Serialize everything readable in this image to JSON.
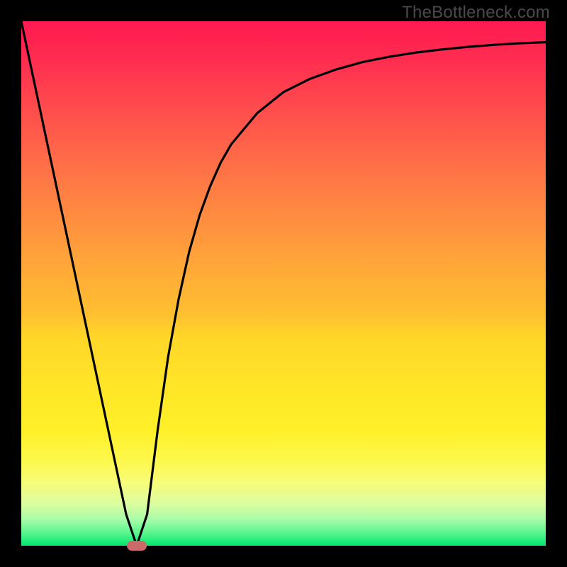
{
  "watermark": "TheBottleneck.com",
  "colors": {
    "frame": "#000000",
    "curve": "#000000",
    "marker": "#cb6a68",
    "gradient_top": "#ff1951",
    "gradient_bottom": "#00e96f"
  },
  "chart_data": {
    "type": "line",
    "title": "",
    "xlabel": "",
    "ylabel": "",
    "xlim": [
      0,
      100
    ],
    "ylim": [
      0,
      100
    ],
    "grid": false,
    "series": [
      {
        "name": "bottleneck-curve",
        "x": [
          0,
          2,
          4,
          6,
          8,
          10,
          12,
          14,
          16,
          18,
          20,
          22,
          24,
          26,
          28,
          30,
          32,
          34,
          36,
          38,
          40,
          45,
          50,
          55,
          60,
          65,
          70,
          75,
          80,
          85,
          90,
          95,
          100
        ],
        "y": [
          100,
          90.6,
          81.2,
          71.8,
          62.4,
          53.0,
          43.6,
          34.2,
          24.8,
          15.4,
          6.0,
          0.0,
          6.0,
          22.0,
          36.0,
          47.0,
          56.0,
          63.0,
          68.5,
          73.0,
          76.5,
          82.5,
          86.5,
          89.0,
          90.8,
          92.2,
          93.2,
          94.0,
          94.6,
          95.1,
          95.5,
          95.8,
          96.0
        ]
      }
    ],
    "annotations": [
      {
        "name": "minimum-marker",
        "x": 22,
        "y": 0
      }
    ]
  }
}
